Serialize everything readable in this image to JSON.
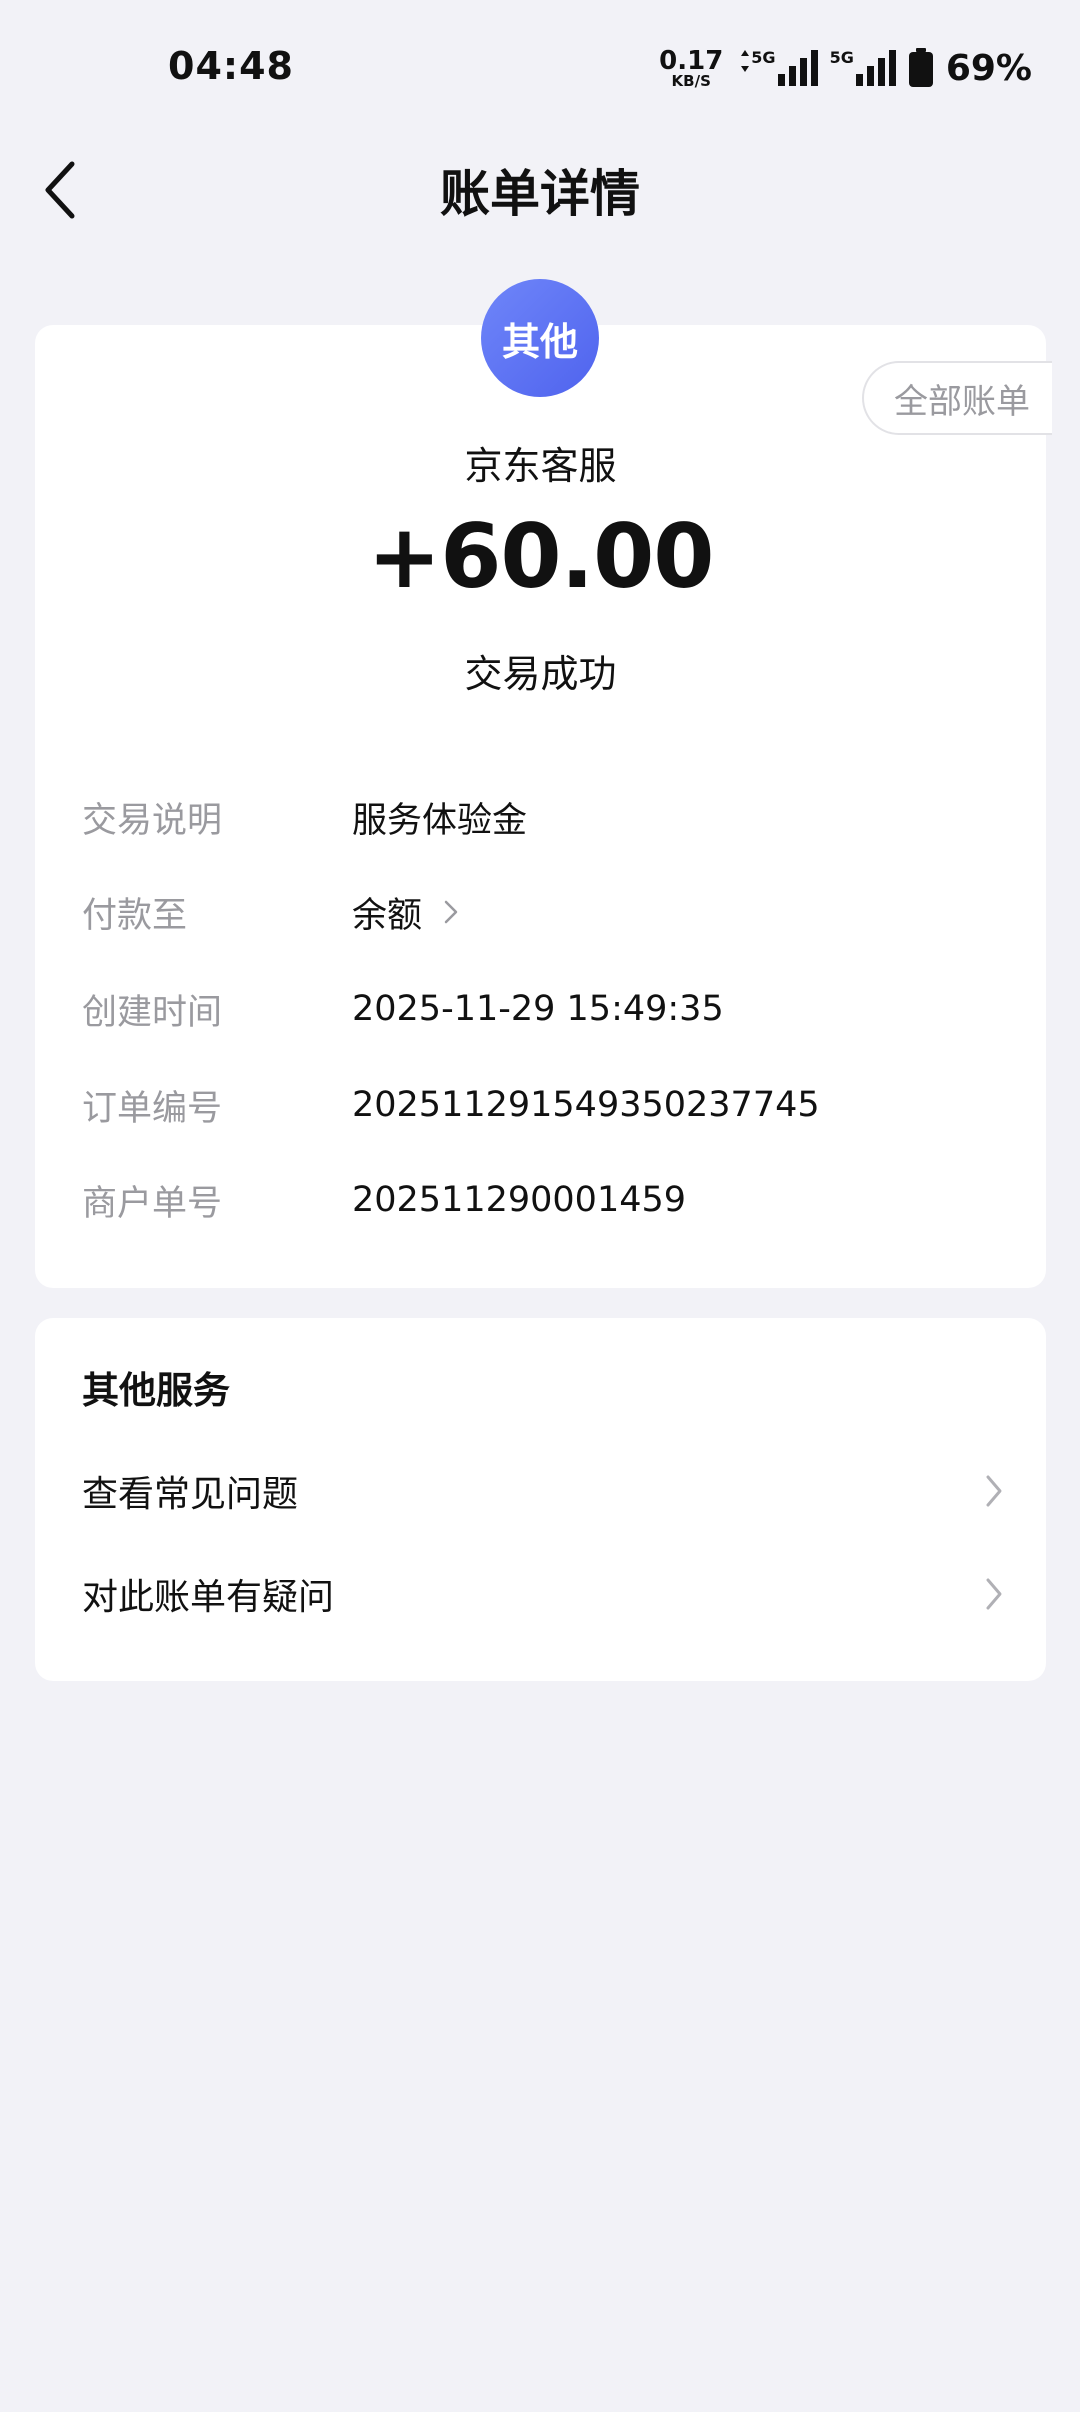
{
  "status_bar": {
    "time": "04:48",
    "speed_value": "0.17",
    "speed_unit": "KB/S",
    "net1_label": "5G",
    "net2_label": "5G",
    "battery_percent": "69%"
  },
  "header": {
    "title": "账单详情",
    "back_icon": "chevron-left-icon"
  },
  "summary": {
    "category_badge": "其他",
    "all_bills_label": "全部账单",
    "merchant": "京东客服",
    "amount": "+60.00",
    "status": "交易成功",
    "badge_color": "#5b6ef2"
  },
  "details": [
    {
      "label": "交易说明",
      "value": "服务体验金"
    },
    {
      "label": "付款至",
      "value": "余额"
    },
    {
      "label": "创建时间",
      "value": "2025-11-29 15:49:35"
    },
    {
      "label": "订单编号",
      "value": "20251129154935023774​5"
    },
    {
      "label": "商户单号",
      "value": "202511290001459"
    }
  ],
  "services": {
    "title": "其他服务",
    "items": [
      {
        "label": "查看常见问题"
      },
      {
        "label": "对此账单有疑问"
      }
    ]
  }
}
